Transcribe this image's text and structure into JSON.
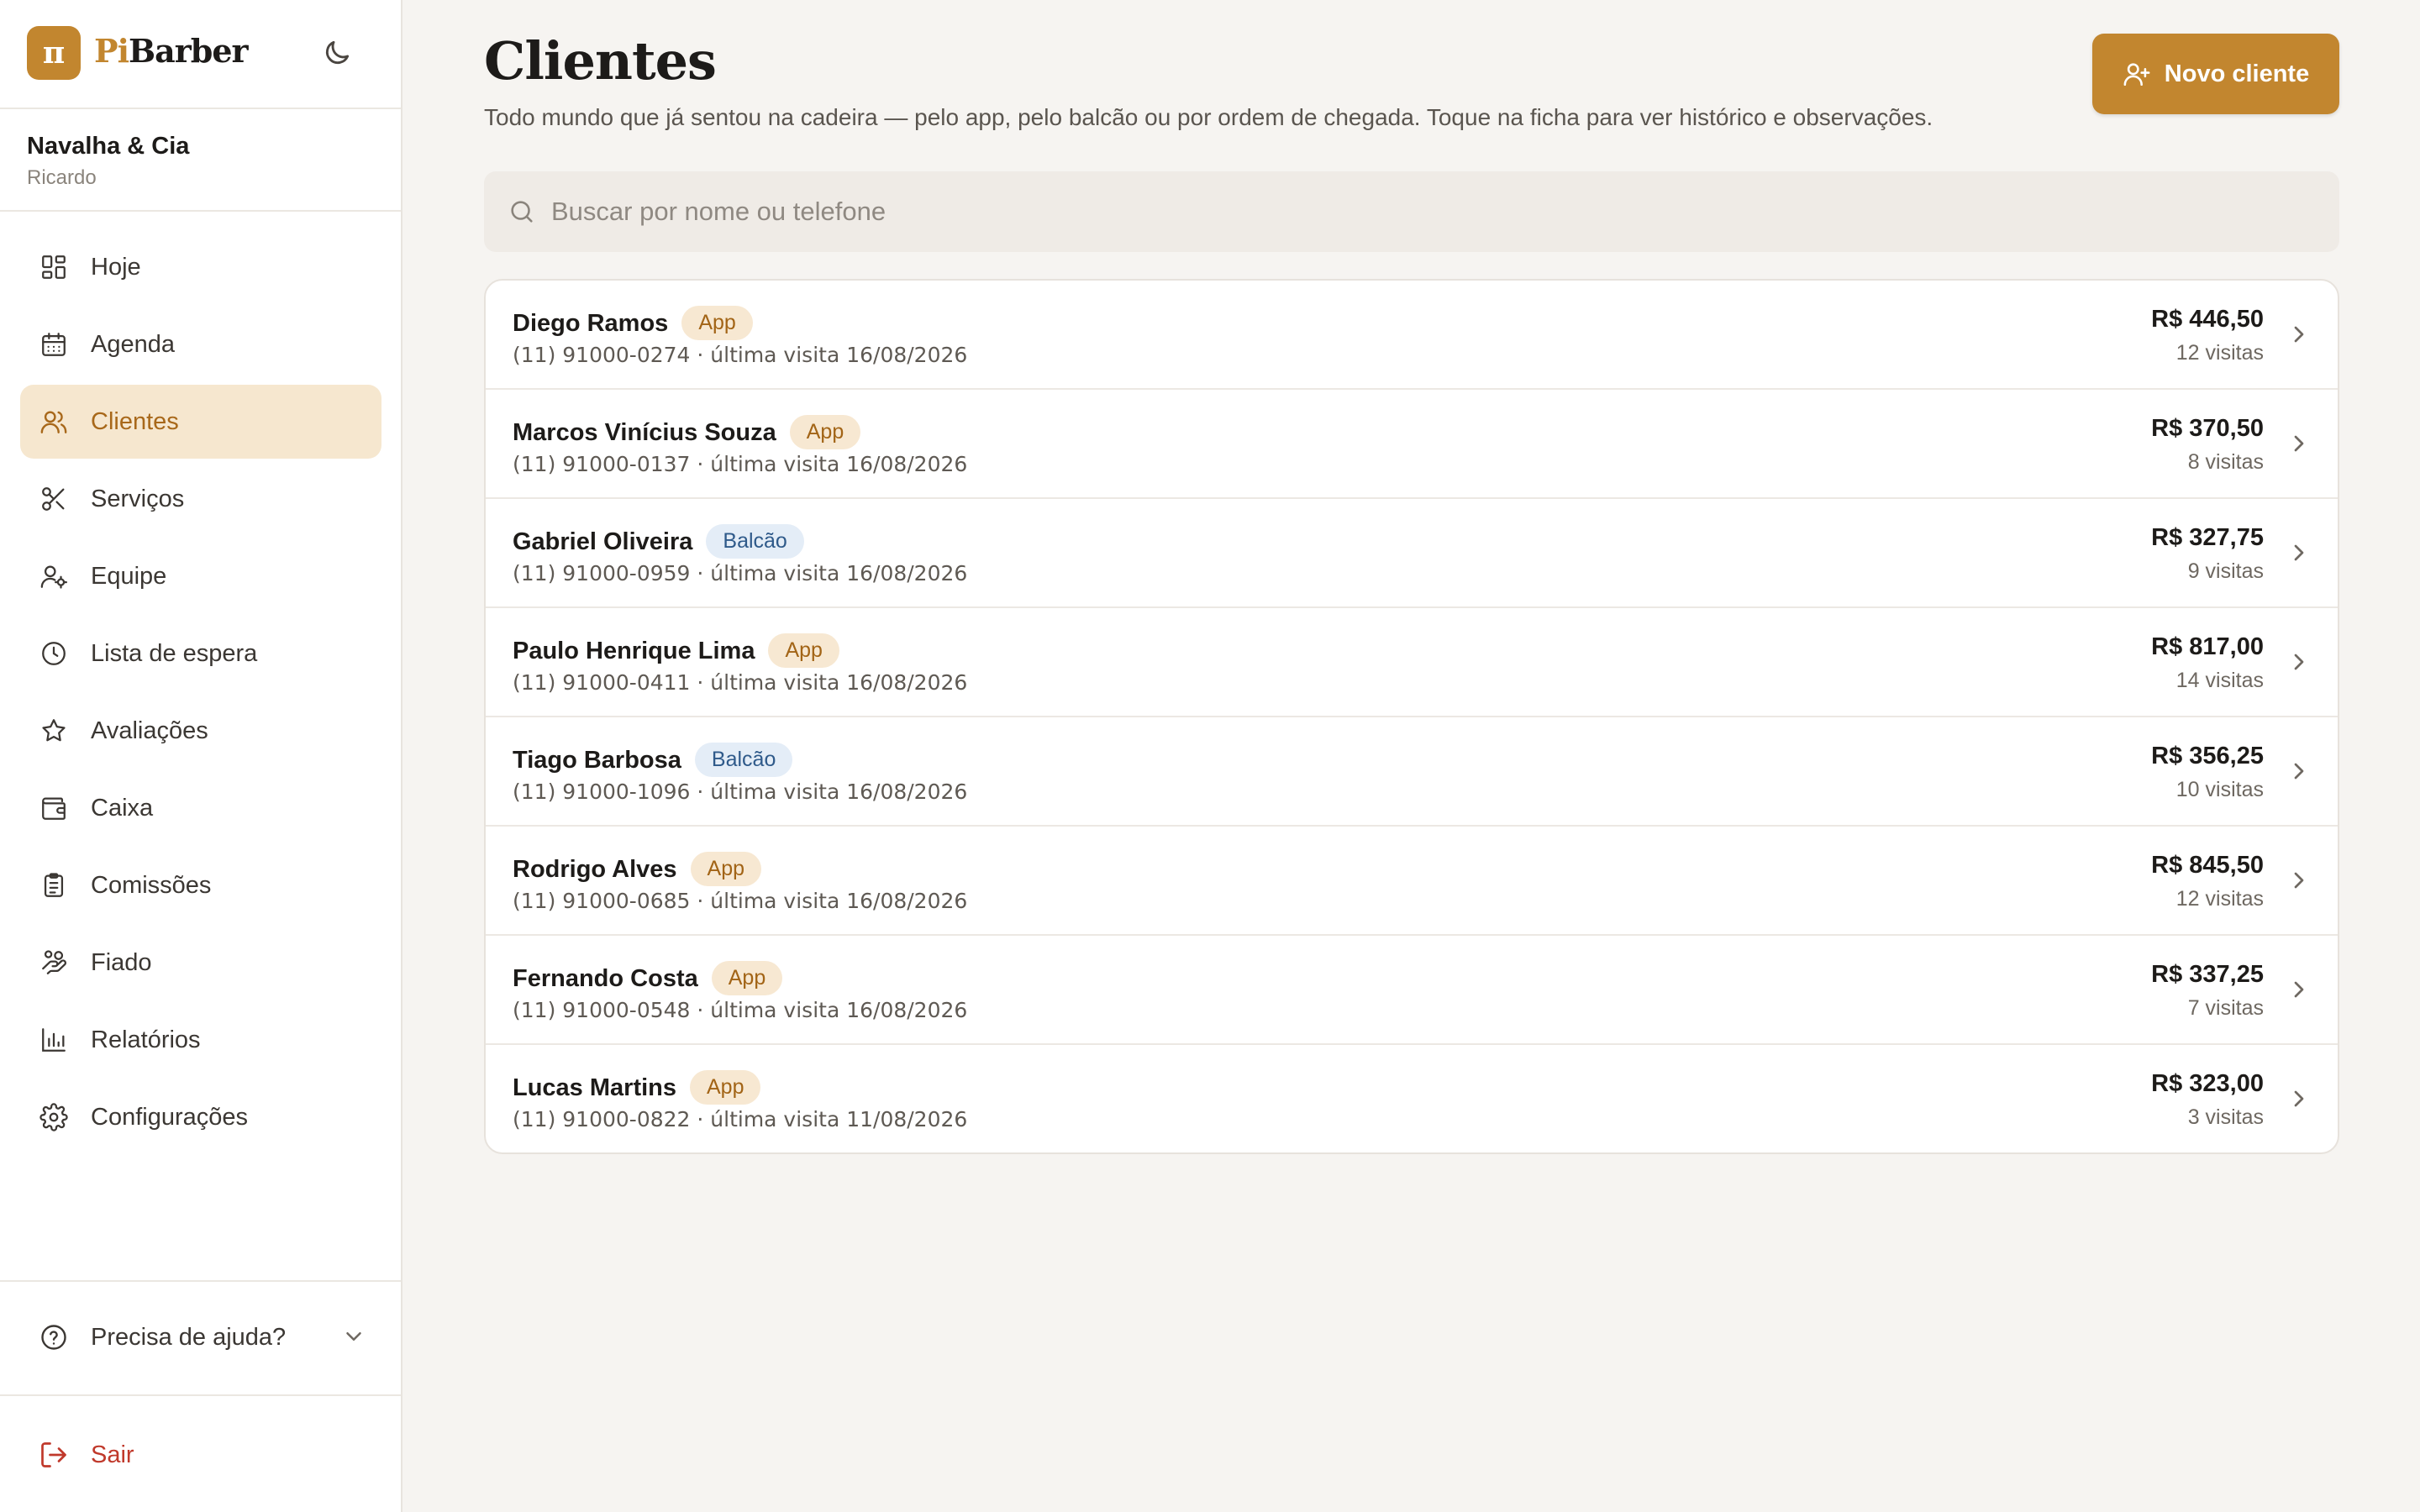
{
  "brand": {
    "logo_glyph": "π",
    "name_prefix": "Pi",
    "name_suffix": "Barber",
    "accent": "#c2862f"
  },
  "shop": {
    "name": "Navalha & Cia",
    "user": "Ricardo"
  },
  "nav": {
    "items": [
      {
        "label": "Hoje",
        "icon": "dashboard-icon"
      },
      {
        "label": "Agenda",
        "icon": "calendar-icon"
      },
      {
        "label": "Clientes",
        "icon": "users-icon",
        "active": true
      },
      {
        "label": "Serviços",
        "icon": "scissors-icon"
      },
      {
        "label": "Equipe",
        "icon": "user-gear-icon"
      },
      {
        "label": "Lista de espera",
        "icon": "clock-icon"
      },
      {
        "label": "Avaliações",
        "icon": "star-icon"
      },
      {
        "label": "Caixa",
        "icon": "wallet-icon"
      },
      {
        "label": "Comissões",
        "icon": "clipboard-icon"
      },
      {
        "label": "Fiado",
        "icon": "hand-coins-icon"
      },
      {
        "label": "Relatórios",
        "icon": "bar-chart-icon"
      },
      {
        "label": "Configurações",
        "icon": "gear-icon"
      }
    ],
    "help_label": "Precisa de ajuda?",
    "logout_label": "Sair"
  },
  "page": {
    "title": "Clientes",
    "subtitle": "Todo mundo que já sentou na cadeira — pelo app, pelo balcão ou por ordem de chegada. Toque na ficha para ver histórico e observações.",
    "new_button_label": "Novo cliente",
    "search_placeholder": "Buscar por nome ou telefone",
    "search_value": ""
  },
  "clients": [
    {
      "name": "Diego Ramos",
      "tag": "App",
      "tag_type": "app",
      "meta": "(11) 91000-0274 · última visita 16/08/2026",
      "total": "R$ 446,50",
      "visits": "12 visitas"
    },
    {
      "name": "Marcos Vinícius Souza",
      "tag": "App",
      "tag_type": "app",
      "meta": "(11) 91000-0137 · última visita 16/08/2026",
      "total": "R$ 370,50",
      "visits": "8 visitas"
    },
    {
      "name": "Gabriel Oliveira",
      "tag": "Balcão",
      "tag_type": "balcao",
      "meta": "(11) 91000-0959 · última visita 16/08/2026",
      "total": "R$ 327,75",
      "visits": "9 visitas"
    },
    {
      "name": "Paulo Henrique Lima",
      "tag": "App",
      "tag_type": "app",
      "meta": "(11) 91000-0411 · última visita 16/08/2026",
      "total": "R$ 817,00",
      "visits": "14 visitas"
    },
    {
      "name": "Tiago Barbosa",
      "tag": "Balcão",
      "tag_type": "balcao",
      "meta": "(11) 91000-1096 · última visita 16/08/2026",
      "total": "R$ 356,25",
      "visits": "10 visitas"
    },
    {
      "name": "Rodrigo Alves",
      "tag": "App",
      "tag_type": "app",
      "meta": "(11) 91000-0685 · última visita 16/08/2026",
      "total": "R$ 845,50",
      "visits": "12 visitas"
    },
    {
      "name": "Fernando Costa",
      "tag": "App",
      "tag_type": "app",
      "meta": "(11) 91000-0548 · última visita 16/08/2026",
      "total": "R$ 337,25",
      "visits": "7 visitas"
    },
    {
      "name": "Lucas Martins",
      "tag": "App",
      "tag_type": "app",
      "meta": "(11) 91000-0822 · última visita 11/08/2026",
      "total": "R$ 323,00",
      "visits": "3 visitas"
    }
  ]
}
